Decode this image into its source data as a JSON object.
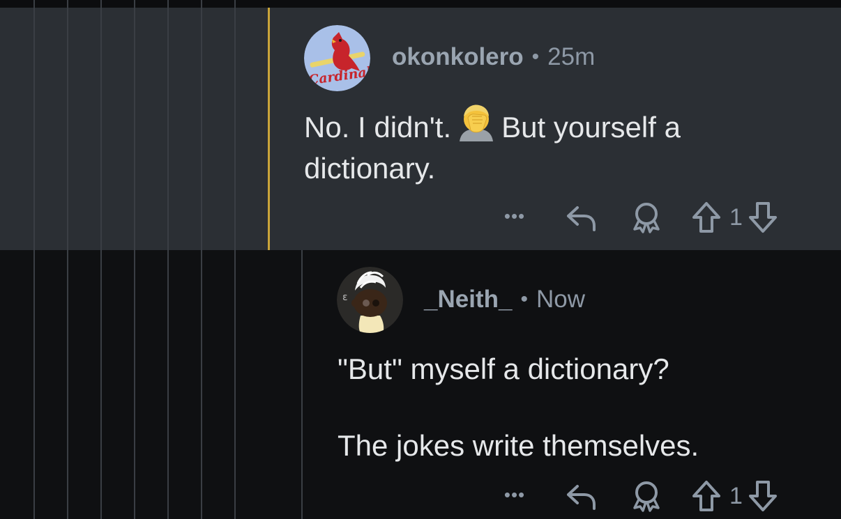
{
  "comments": [
    {
      "username": "okonkolero",
      "separator": "•",
      "time": "25m",
      "avatar_text": "Cardinals",
      "body_before_emoji": "No. I didn't.",
      "emoji_icon": "face-palm-emoji",
      "body_after_emoji": "But yourself a",
      "body_line2": "dictionary.",
      "more_label": "•••",
      "score": "1",
      "accent_color": "#c9a53a"
    },
    {
      "username": "_Neith_",
      "separator": "•",
      "time": "Now",
      "paragraph1": "\"But\" myself a dictionary?",
      "paragraph2": "The jokes write themselves.",
      "more_label": "•••",
      "score": "1"
    }
  ],
  "colors": {
    "background": "#0f1012",
    "highlight": "#2b2f34",
    "text": "#e6e8ea",
    "muted": "#8e99a6"
  }
}
